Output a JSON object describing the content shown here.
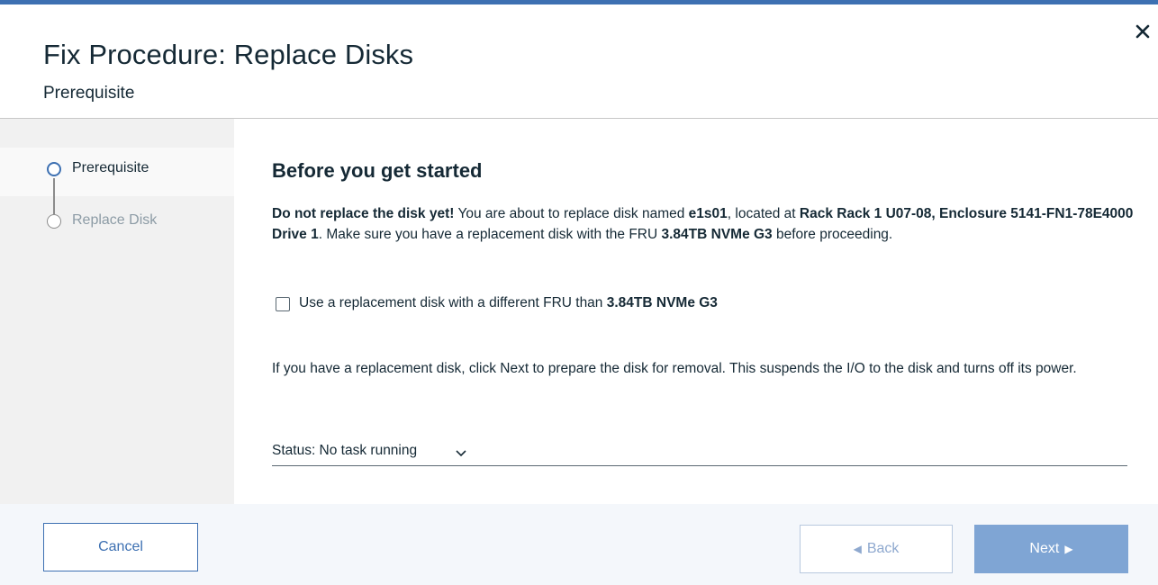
{
  "dialog": {
    "title": "Fix Procedure: Replace Disks",
    "subtitle": "Prerequisite"
  },
  "steps": [
    {
      "label": "Prerequisite",
      "state": "active"
    },
    {
      "label": "Replace Disk",
      "state": "inactive"
    }
  ],
  "content": {
    "heading": "Before you get started",
    "warning_bold": "Do not replace the disk yet!",
    "text_1": " You are about to replace disk named ",
    "disk_name": "e1s01",
    "text_2": ", located at ",
    "location": "Rack Rack 1 U07-08, Enclosure 5141-FN1-78E4000 Drive 1",
    "text_3": ". Make sure you have a replacement disk with the FRU ",
    "fru": "3.84TB NVMe G3",
    "text_4": " before proceeding.",
    "checkbox_label": "Use a replacement disk with a different FRU than ",
    "checkbox_fru": "3.84TB NVMe G3",
    "checkbox_checked": false,
    "instructions": "If you have a replacement disk, click Next to prepare the disk for removal. This suspends the I/O to the disk and turns off its power.",
    "status": "Status: No task running"
  },
  "footer": {
    "cancel_label": "Cancel",
    "back_label": "Back",
    "next_label": "Next"
  },
  "icons": {
    "close": "close-icon",
    "status_toggle": "chevron-down-icon",
    "back": "triangle-left-icon",
    "next": "triangle-right-icon"
  },
  "colors": {
    "accent": "#3d70b2",
    "next_button": "#7fa5d4",
    "sidebar": "#f1f1f1",
    "footer": "#f4f7fb"
  }
}
